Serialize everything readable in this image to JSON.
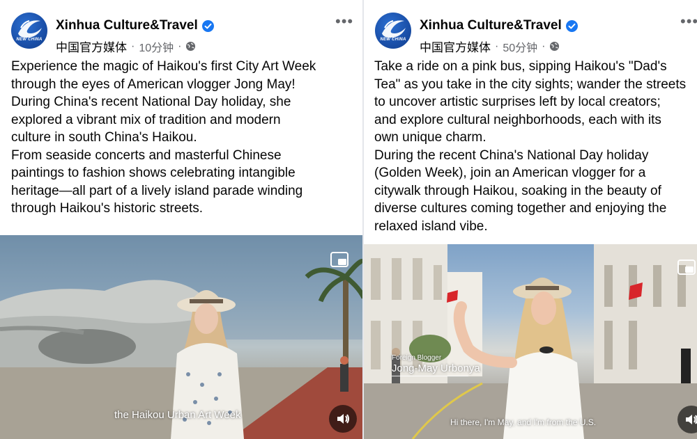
{
  "posts": [
    {
      "page_name": "Xinhua Culture&Travel",
      "avatar_text": "NEW CHINA",
      "media_label": "中国官方媒体",
      "time_ago": "10分钟",
      "separator": "·",
      "more_label": "•••",
      "body": "Experience the magic of Haikou's first City Art Week\nthrough the eyes of American vlogger Jong May!\nDuring China's recent National Day holiday, she\nexplored a vibrant mix of tradition and modern\nculture in south China's Haikou.\nFrom seaside concerts and masterful Chinese\npaintings to fashion shows celebrating intangible\nheritage—all part of a lively island parade winding\nthrough Haikou's historic streets.",
      "video": {
        "subtitle": "the Haikou Urban Art Week"
      }
    },
    {
      "page_name": "Xinhua Culture&Travel",
      "avatar_text": "NEW CHINA",
      "media_label": "中国官方媒体",
      "time_ago": "50分钟",
      "separator": "·",
      "more_label": "•••",
      "body": "Take a ride on a pink bus, sipping Haikou's \"Dad's\nTea\" as you take in the city sights; wander the streets\nto uncover artistic surprises left by local creators;\nand explore cultural neighborhoods, each with its\nown unique charm.\nDuring the recent China's National Day holiday\n(Golden Week), join an American vlogger for a\ncitywalk through Haikou, soaking in the beauty of\ndiverse cultures coming together and enjoying the\nrelaxed island vibe.",
      "video": {
        "lower_third_label": "Foreign Blogger",
        "lower_third_name": "Jong-May Urbonya",
        "subtitle": "Hi there, I'm May, and I'm from the U.S."
      }
    }
  ],
  "colors": {
    "verified": "#1877f2",
    "secondary_text": "#65676b",
    "primary_text": "#050505"
  },
  "icons": [
    "verified-badge-icon",
    "globe-icon",
    "more-options-icon",
    "picture-in-picture-icon",
    "speaker-icon"
  ]
}
